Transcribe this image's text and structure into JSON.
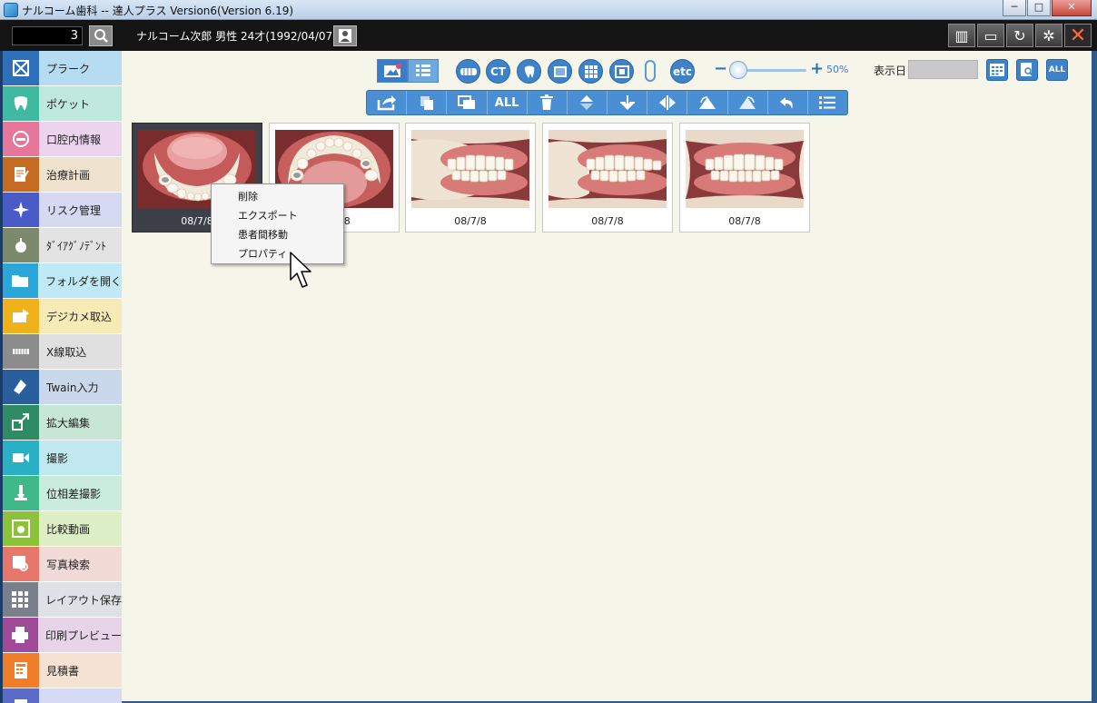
{
  "window": {
    "title": "ナルコーム歯科  --  達人プラス Version6(Version 6.19)",
    "minimize": "─",
    "maximize": "□",
    "close": "✕"
  },
  "header": {
    "patient_id": "3",
    "patient_info": "ナルコーム次郎 男性 24才(1992/04/07)"
  },
  "sidebar": {
    "items": [
      {
        "label": "プラーク",
        "icon": "plaque-icon",
        "icon_bg": "#2d6fb8",
        "bg": "#b6dcf2"
      },
      {
        "label": "ポケット",
        "icon": "tooth-pocket-icon",
        "icon_bg": "#3fb9a0",
        "bg": "#bfe8df"
      },
      {
        "label": "口腔内情報",
        "icon": "mouth-icon",
        "icon_bg": "#e6779a",
        "bg": "#ecd3ee"
      },
      {
        "label": "治療計画",
        "icon": "treatment-plan-icon",
        "icon_bg": "#c56b22",
        "bg": "#efe2cf"
      },
      {
        "label": "リスク管理",
        "icon": "risk-icon",
        "icon_bg": "#4a5bc8",
        "bg": "#d6d9f2"
      },
      {
        "label": "ﾀﾞｲｱｸﾞﾉﾃﾞﾝﾄ",
        "icon": "diagnodent-icon",
        "icon_bg": "#7a8a6a",
        "bg": "#e3e3e3"
      },
      {
        "label": "フォルダを開く",
        "icon": "folder-icon",
        "icon_bg": "#2aa7d8",
        "bg": "#bfe9f4"
      },
      {
        "label": "デジカメ取込",
        "icon": "camera-import-icon",
        "icon_bg": "#f0b21a",
        "bg": "#f6eab6"
      },
      {
        "label": "X線取込",
        "icon": "xray-icon",
        "icon_bg": "#8c8c8c",
        "bg": "#e0e0e0"
      },
      {
        "label": "Twain入力",
        "icon": "twain-icon",
        "icon_bg": "#2a5f9e",
        "bg": "#c9d8ea"
      },
      {
        "label": "拡大編集",
        "icon": "zoom-edit-icon",
        "icon_bg": "#2e8b63",
        "bg": "#c8e6d6"
      },
      {
        "label": "撮影",
        "icon": "video-icon",
        "icon_bg": "#29b0c4",
        "bg": "#c1e8ee"
      },
      {
        "label": "位相差撮影",
        "icon": "microscope-icon",
        "icon_bg": "#3fb98a",
        "bg": "#c9ecdc"
      },
      {
        "label": "比較動画",
        "icon": "compare-video-icon",
        "icon_bg": "#8bc23a",
        "bg": "#dcefc6"
      },
      {
        "label": "写真検索",
        "icon": "photo-search-icon",
        "icon_bg": "#e6776a",
        "bg": "#f2dad6"
      },
      {
        "label": "レイアウト保存",
        "icon": "layout-icon",
        "icon_bg": "#7a7f8c",
        "bg": "#dfe1e6"
      },
      {
        "label": "印刷プレビュー",
        "icon": "print-icon",
        "icon_bg": "#a04a9a",
        "bg": "#e8d4e8"
      },
      {
        "label": "見積書",
        "icon": "estimate-icon",
        "icon_bg": "#f07d2a",
        "bg": "#f4e2d2"
      },
      {
        "label": "",
        "icon": "history-icon",
        "icon_bg": "#5a6bc8",
        "bg": "#d6daf2"
      }
    ]
  },
  "toolbar": {
    "ct": "CT",
    "etc": "etc",
    "zoom_value": "50%",
    "date_label": "表示日",
    "all_label": "ALL"
  },
  "thumbnails": [
    {
      "date": "08/7/8",
      "selected": true,
      "kind": "lower-occlusal"
    },
    {
      "date": "08/7/8",
      "selected": false,
      "kind": "upper-occlusal"
    },
    {
      "date": "08/7/8",
      "selected": false,
      "kind": "right-lateral"
    },
    {
      "date": "08/7/8",
      "selected": false,
      "kind": "left-lateral"
    },
    {
      "date": "08/7/8",
      "selected": false,
      "kind": "frontal"
    }
  ],
  "context_menu": {
    "items": [
      "削除",
      "エクスポート",
      "患者間移動",
      "プロパティ"
    ]
  }
}
